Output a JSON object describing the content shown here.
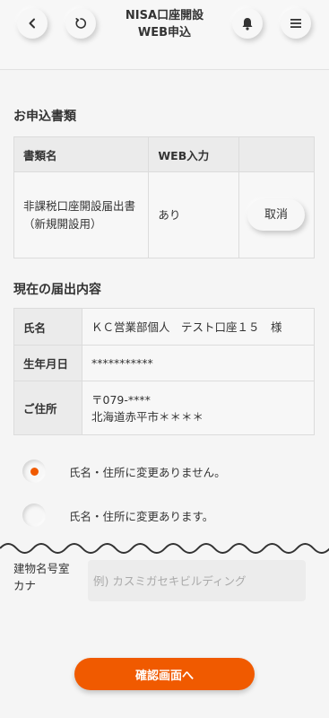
{
  "header": {
    "title_line1": "NISA口座開設",
    "title_line2": "WEB申込"
  },
  "documents": {
    "section_title": "お申込書類",
    "col_name": "書類名",
    "col_web": "WEB入力",
    "row": {
      "name": "非課税口座開設届出書（新規開設用）",
      "web": "あり",
      "cancel_label": "取消"
    }
  },
  "current": {
    "section_title": "現在の届出内容",
    "rows": [
      {
        "label": "氏名",
        "value": "ＫＣ営業部個人　テスト口座１５　様"
      },
      {
        "label": "生年月日",
        "value": "***********"
      },
      {
        "label": "ご住所",
        "value_line1": "〒079-****",
        "value_line2": "北海道赤平市＊＊＊＊"
      }
    ]
  },
  "change_options": [
    {
      "label": "氏名・住所に変更ありません。",
      "selected": true
    },
    {
      "label": "氏名・住所に変更あります。",
      "selected": false
    }
  ],
  "building_kana": {
    "label_line1": "建物名号室",
    "label_line2": "カナ",
    "placeholder": "例) カスミガセキビルディング",
    "value": ""
  },
  "confirm_label": "確認画面へ",
  "colors": {
    "accent": "#f05a00",
    "background": "#f5f5f5"
  }
}
